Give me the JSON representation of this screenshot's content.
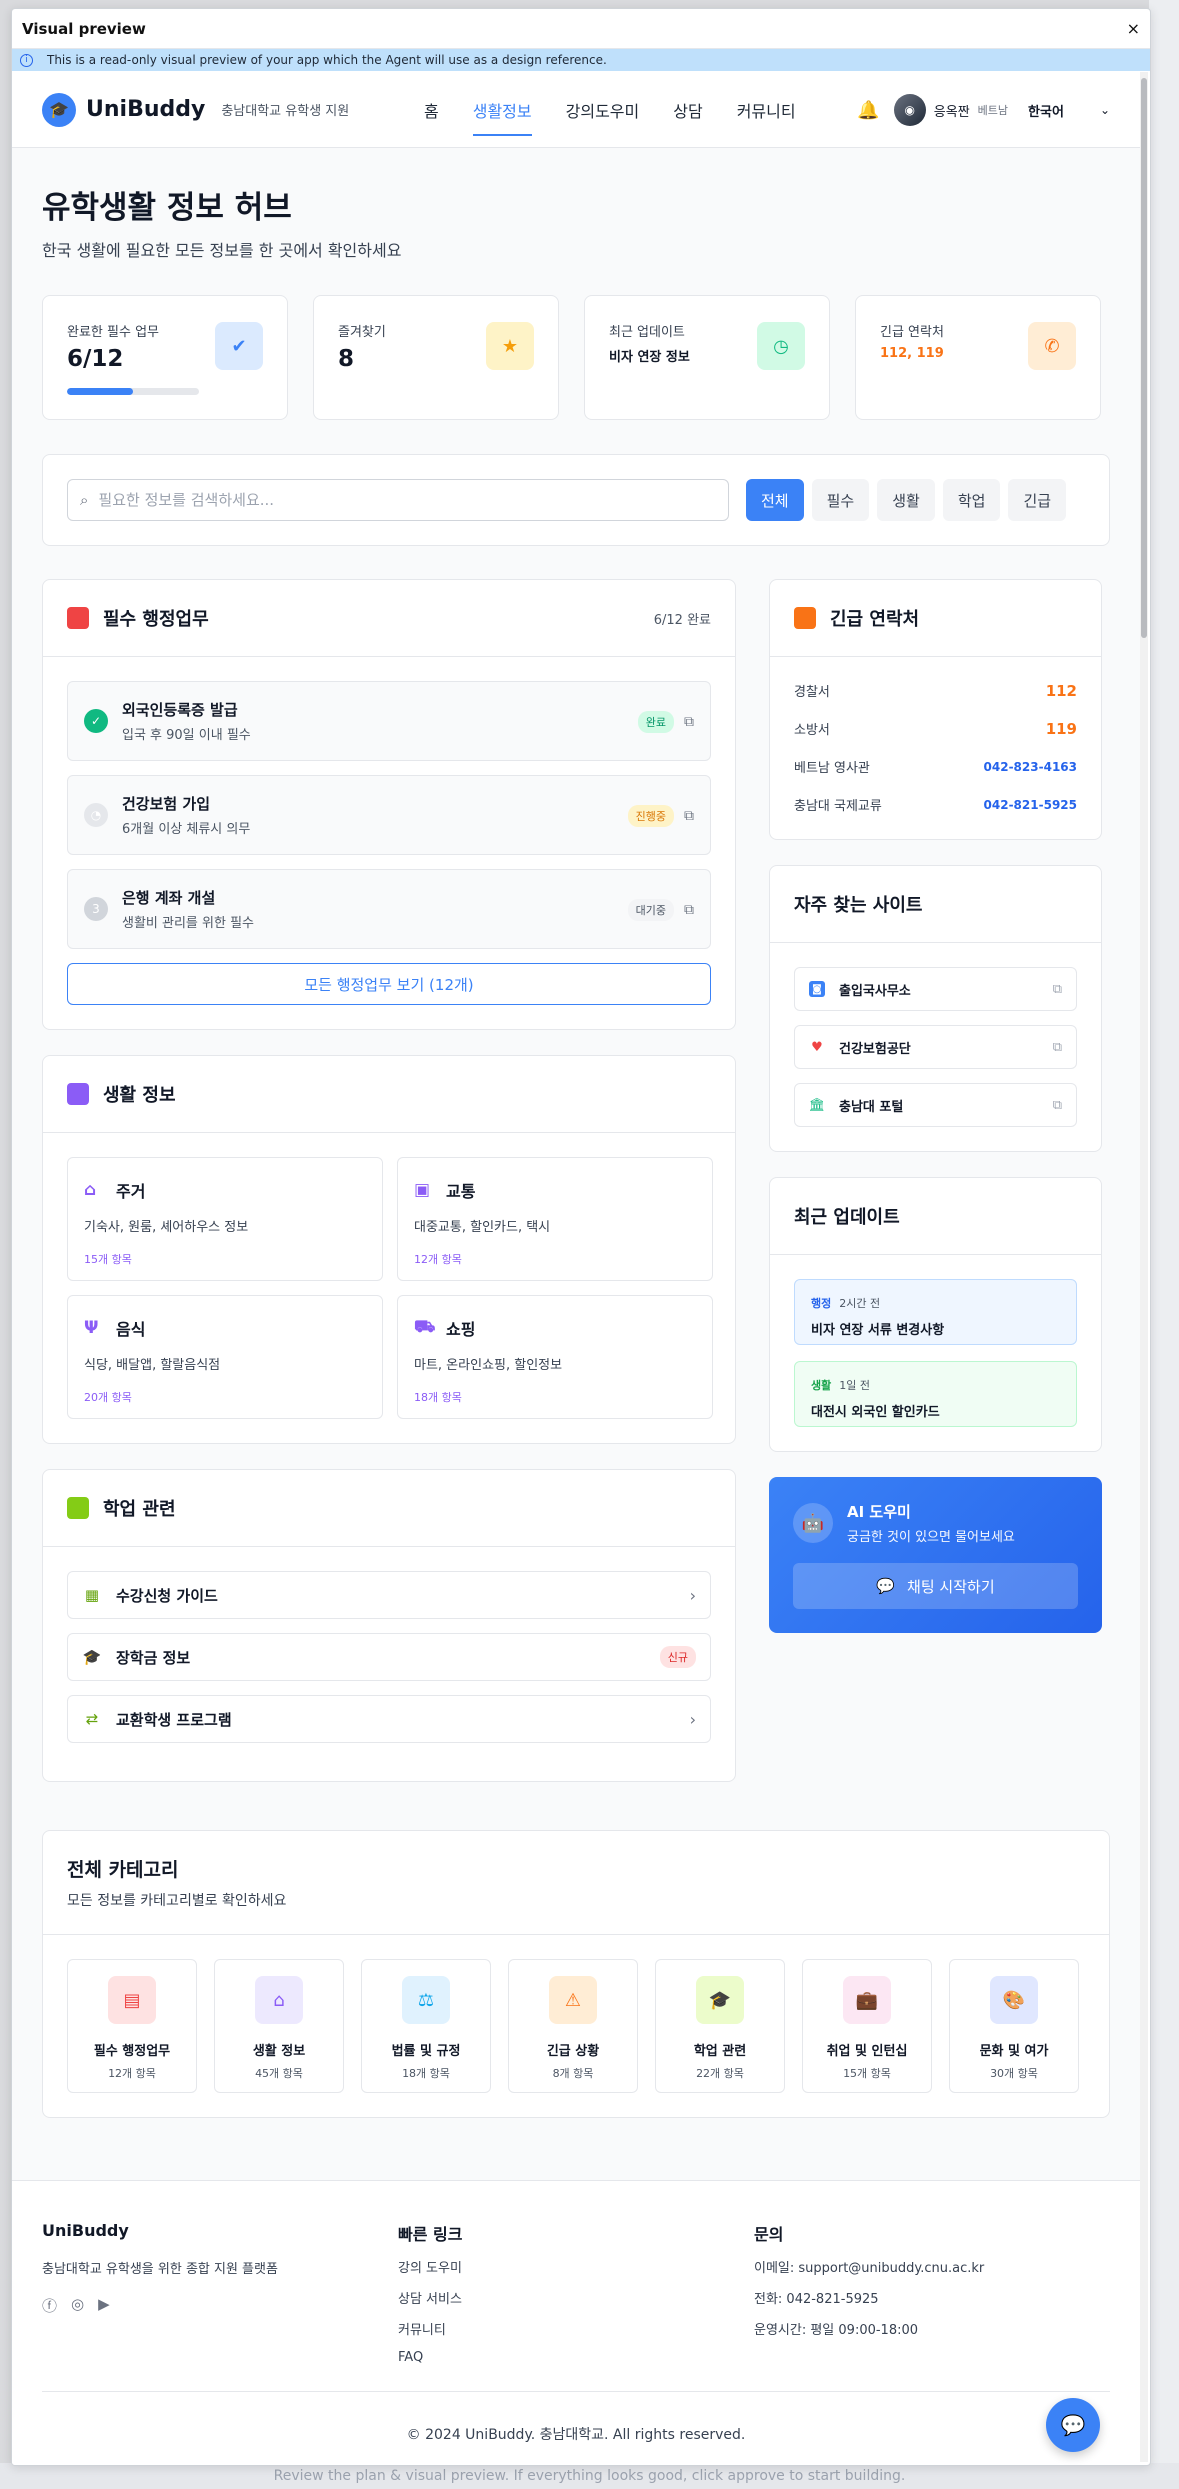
{
  "dialog": {
    "title": "Visual preview",
    "close": "×",
    "notice": "This is a read-only visual preview of your app which the Agent will use as a design reference."
  },
  "background": {
    "bottom_text": "Review the plan & visual preview. If everything looks good, click approve to start building."
  },
  "nav": {
    "logo": "UniBuddy",
    "sub": "충남대학교 유학생 지원",
    "links": [
      "홈",
      "생활정보",
      "강의도우미",
      "상담",
      "커뮤니티"
    ],
    "active_link": "생활정보",
    "user_name": "응옥짠",
    "user_country": "베트남",
    "language": "한국어"
  },
  "hero": {
    "title": "유학생활 정보 허브",
    "subtitle": "한국 생활에 필요한 모든 정보를 한 곳에서 확인하세요"
  },
  "stats": [
    {
      "label": "완료한 필수 업무",
      "value": "6/12",
      "progress": 0.5
    },
    {
      "label": "즐겨찾기",
      "value": "8"
    },
    {
      "label": "최근 업데이트",
      "value": "비자 연장 정보"
    },
    {
      "label": "긴급 연락처",
      "value": "112, 119"
    }
  ],
  "search": {
    "placeholder": "필요한 정보를 검색하세요...",
    "filters": [
      "전체",
      "필수",
      "생활",
      "학업",
      "긴급"
    ],
    "active": "전체"
  },
  "admin": {
    "title": "필수 행정업무",
    "meta": "6/12 완료",
    "tasks": [
      {
        "title": "외국인등록증 발급",
        "sub": "입국 후 90일 이내 필수",
        "status": "완료"
      },
      {
        "title": "건강보험 가입",
        "sub": "6개월 이상 체류시 의무",
        "status": "진행중"
      },
      {
        "title": "은행 계좌 개설",
        "sub": "생활비 관리를 위한 필수",
        "status": "대기중"
      }
    ],
    "step3": "3",
    "button": "모든 행정업무 보기 (12개)"
  },
  "life": {
    "title": "생활 정보",
    "items": [
      {
        "title": "주거",
        "desc": "기숙사, 원룸, 셰어하우스 정보",
        "count": "15개 항목"
      },
      {
        "title": "교통",
        "desc": "대중교통, 할인카드, 택시",
        "count": "12개 항목"
      },
      {
        "title": "음식",
        "desc": "식당, 배달앱, 할랄음식점",
        "count": "20개 항목"
      },
      {
        "title": "쇼핑",
        "desc": "마트, 온라인쇼핑, 할인정보",
        "count": "18개 항목"
      }
    ]
  },
  "academic": {
    "title": "학업 관련",
    "items": [
      {
        "label": "수강신청 가이드"
      },
      {
        "label": "장학금 정보",
        "badge": "신규"
      },
      {
        "label": "교환학생 프로그램"
      }
    ]
  },
  "emergency": {
    "title": "긴급 연락처",
    "items": [
      {
        "name": "경찰서",
        "value": "112"
      },
      {
        "name": "소방서",
        "value": "119"
      },
      {
        "name": "베트남 영사관",
        "value": "042-823-4163"
      },
      {
        "name": "충남대 국제교류",
        "value": "042-821-5925"
      }
    ]
  },
  "sites": {
    "title": "자주 찾는 사이트",
    "items": [
      "출입국사무소",
      "건강보험공단",
      "충남대 포털"
    ]
  },
  "updates": {
    "title": "최근 업데이트",
    "items": [
      {
        "tag": "행정",
        "time": "2시간 전",
        "title": "비자 연장 서류 변경사항"
      },
      {
        "tag": "생활",
        "time": "1일 전",
        "title": "대전시 외국인 할인카드"
      }
    ]
  },
  "ai": {
    "title": "AI 도우미",
    "sub": "궁금한 것이 있으면 물어보세요",
    "button": "채팅 시작하기"
  },
  "categories": {
    "title": "전체 카테고리",
    "subtitle": "모든 정보를 카테고리별로 확인하세요",
    "items": [
      {
        "label": "필수 행정업무",
        "count": "12개 항목"
      },
      {
        "label": "생활 정보",
        "count": "45개 항목"
      },
      {
        "label": "법률 및 규정",
        "count": "18개 항목"
      },
      {
        "label": "긴급 상황",
        "count": "8개 항목"
      },
      {
        "label": "학업 관련",
        "count": "22개 항목"
      },
      {
        "label": "취업 및 인턴십",
        "count": "15개 항목"
      },
      {
        "label": "문화 및 여가",
        "count": "30개 항목"
      }
    ]
  },
  "footer": {
    "brand": "UniBuddy",
    "desc": "충남대학교 유학생을 위한 종합 지원 플랫폼",
    "quick_title": "빠른 링크",
    "quick_links": [
      "강의 도우미",
      "상담 서비스",
      "커뮤니티",
      "FAQ"
    ],
    "contact_title": "문의",
    "contact": [
      "이메일: support@unibuddy.cnu.ac.kr",
      "전화: 042-821-5925",
      "운영시간: 평일 09:00-18:00"
    ],
    "copyright": "© 2024 UniBuddy. 충남대학교. All rights reserved."
  },
  "colors": {
    "primary": "#3b82f6",
    "admin": "#ef4444",
    "life": "#8b5cf6",
    "academic": "#84cc16",
    "emergency": "#f97316"
  }
}
